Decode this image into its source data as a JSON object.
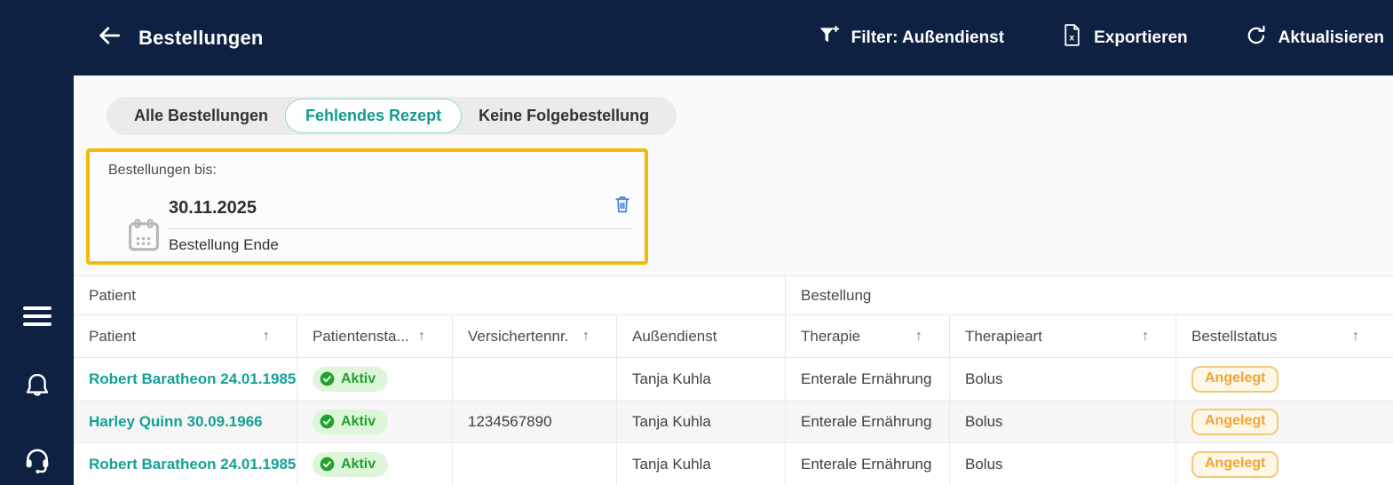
{
  "header": {
    "title": "Bestellungen",
    "actions": [
      {
        "icon": "filter-plus-icon",
        "label": "Filter: Außendienst"
      },
      {
        "icon": "export-excel-icon",
        "label": "Exportieren"
      },
      {
        "icon": "refresh-icon",
        "label": "Aktualisieren"
      }
    ]
  },
  "sidebar": {
    "icons": [
      "menu-icon",
      "bell-icon",
      "headset-icon"
    ]
  },
  "tabs": [
    {
      "label": "Alle Bestellungen",
      "active": false
    },
    {
      "label": "Fehlendes Rezept",
      "active": true
    },
    {
      "label": "Keine Folgebestellung",
      "active": false
    }
  ],
  "date_filter": {
    "label": "Bestellungen bis:",
    "value": "30.11.2025",
    "helper": "Bestellung Ende"
  },
  "table": {
    "groups": [
      {
        "label": "Patient",
        "span": 4
      },
      {
        "label": "Bestellung",
        "span": 3
      }
    ],
    "columns": [
      {
        "key": "patient",
        "label": "Patient",
        "sortable": true
      },
      {
        "key": "patientenstatus",
        "label": "Patientensta...",
        "sortable": true
      },
      {
        "key": "versichertennr",
        "label": "Versichertennr.",
        "sortable": true
      },
      {
        "key": "aussendienst",
        "label": "Außendienst",
        "sortable": false
      },
      {
        "key": "therapie",
        "label": "Therapie",
        "sortable": true
      },
      {
        "key": "therapieart",
        "label": "Therapieart",
        "sortable": true
      },
      {
        "key": "bestellstatus",
        "label": "Bestellstatus",
        "sortable": true
      }
    ],
    "rows": [
      {
        "patient": "Robert Baratheon 24.01.1985",
        "patientenstatus": "Aktiv",
        "versichertennr": "",
        "aussendienst": "Tanja Kuhla",
        "therapie": "Enterale Ernährung",
        "therapieart": "Bolus",
        "bestellstatus": "Angelegt"
      },
      {
        "patient": "Harley Quinn 30.09.1966",
        "patientenstatus": "Aktiv",
        "versichertennr": "1234567890",
        "aussendienst": "Tanja Kuhla",
        "therapie": "Enterale Ernährung",
        "therapieart": "Bolus",
        "bestellstatus": "Angelegt"
      },
      {
        "patient": "Robert Baratheon 24.01.1985",
        "patientenstatus": "Aktiv",
        "versichertennr": "",
        "aussendienst": "Tanja Kuhla",
        "therapie": "Enterale Ernährung",
        "therapieart": "Bolus",
        "bestellstatus": "Angelegt"
      }
    ]
  },
  "colors": {
    "navy": "#0e2142",
    "teal": "#14a195",
    "highlight_yellow": "#f2b90d",
    "status_green": "#1fa32b",
    "order_amber": "#f1a437",
    "trash_blue": "#4285d6"
  }
}
